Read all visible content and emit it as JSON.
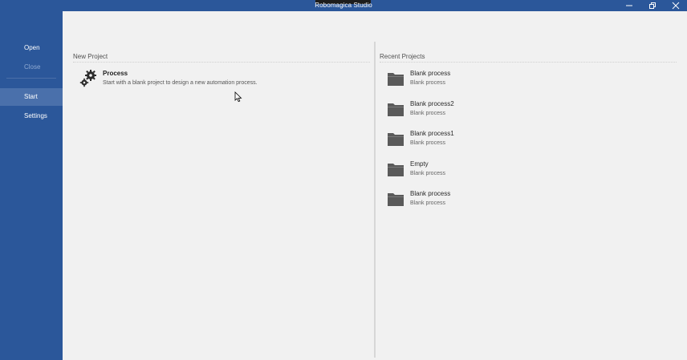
{
  "window": {
    "title": "Robomagica Studio",
    "controls": {
      "minimize": "minimize-icon",
      "restore": "restore-icon",
      "close": "close-icon"
    }
  },
  "sidebar": {
    "items": [
      {
        "label": "Open",
        "state": "normal"
      },
      {
        "label": "Close",
        "state": "disabled"
      },
      {
        "label": "Start",
        "state": "selected"
      },
      {
        "label": "Settings",
        "state": "normal"
      }
    ]
  },
  "new_project": {
    "heading": "New Project",
    "items": [
      {
        "icon": "gears-icon",
        "title": "Process",
        "description": "Start with a blank project to design a new automation process."
      }
    ]
  },
  "recent_projects": {
    "heading": "Recent Projects",
    "items": [
      {
        "icon": "folder-icon",
        "name": "Blank process",
        "type": "Blank process"
      },
      {
        "icon": "folder-icon",
        "name": "Blank process2",
        "type": "Blank process"
      },
      {
        "icon": "folder-icon",
        "name": "Blank process1",
        "type": "Blank process"
      },
      {
        "icon": "folder-icon",
        "name": "Empty",
        "type": "Blank process"
      },
      {
        "icon": "folder-icon",
        "name": "Blank process",
        "type": "Blank process"
      }
    ]
  },
  "colors": {
    "accent": "#2b579a",
    "sidebar_selected": "#4a70ab",
    "background": "#f1f1f1",
    "folder": "#5a5a5a"
  }
}
